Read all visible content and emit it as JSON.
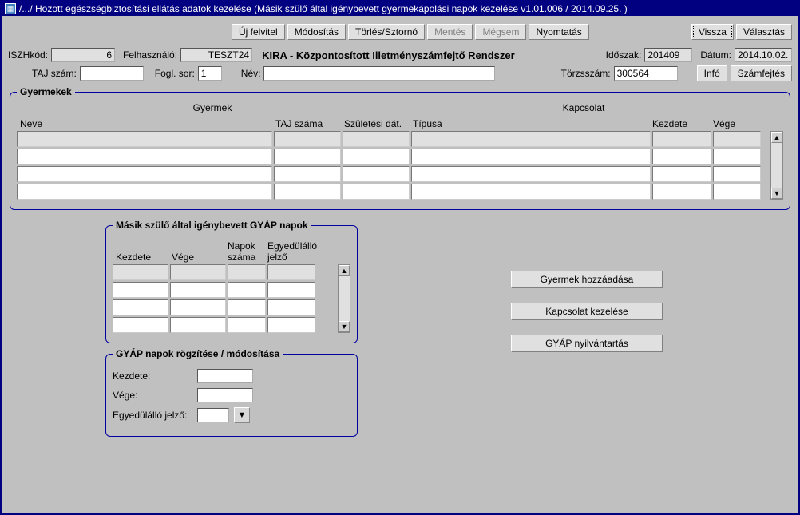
{
  "title": "/.../ Hozott egészségbiztosítási ellátás adatok kezelése (Másik szülő által igénybevett gyermekápolási napok kezelése v1.01.006 / 2014.09.25. )",
  "toolbar": {
    "uj_felvitel": "Új felvitel",
    "modositas": "Módosítás",
    "torles_sztorno": "Törlés/Sztornó",
    "mentes": "Mentés",
    "megsem": "Mégsem",
    "nyomtatas": "Nyomtatás",
    "vissza": "Vissza",
    "valasztas": "Választás"
  },
  "header": {
    "iszhkod_lbl": "ISZHkód:",
    "iszhkod_val": "6",
    "felhasznalo_lbl": "Felhasználó:",
    "felhasznalo_val": "TESZT24",
    "app_title": "KIRA - Központosított Illetményszámfejtő Rendszer",
    "idoszak_lbl": "Időszak:",
    "idoszak_val": "201409",
    "datum_lbl": "Dátum:",
    "datum_val": "2014.10.02.",
    "taj_lbl": "TAJ szám:",
    "taj_val": "",
    "fogl_sor_lbl": "Fogl. sor:",
    "fogl_sor_val": "1",
    "nev_lbl": "Név:",
    "nev_val": "",
    "torzsszam_lbl": "Törzsszám:",
    "torzsszam_val": "300564",
    "info_btn": "Infó",
    "szamfejtes_btn": "Számfejtés"
  },
  "gyermekek": {
    "legend": "Gyermekek",
    "group_gyermek": "Gyermek",
    "group_kapcsolat": "Kapcsolat",
    "col_neve": "Neve",
    "col_taj": "TAJ száma",
    "col_szul": "Születési dát.",
    "col_tipus": "Típusa",
    "col_kezdete": "Kezdete",
    "col_vege": "Vége"
  },
  "gyap_napok": {
    "legend": "Másik szülő által igénybevett GYÁP napok",
    "col_kezdete": "Kezdete",
    "col_vege": "Vége",
    "col_napok": "Napok száma",
    "col_egyedul": "Egyedülálló jelző"
  },
  "gyap_rogz": {
    "legend": "GYÁP napok rögzítése / módosítása",
    "kezdete_lbl": "Kezdete:",
    "vege_lbl": "Vége:",
    "egyedul_lbl": "Egyedülálló jelző:"
  },
  "side": {
    "gyermek_hozzaadasa": "Gyermek hozzáadása",
    "kapcsolat_kezelese": "Kapcsolat kezelése",
    "gyap_nyilvantartas": "GYÁP nyilvántartás"
  }
}
